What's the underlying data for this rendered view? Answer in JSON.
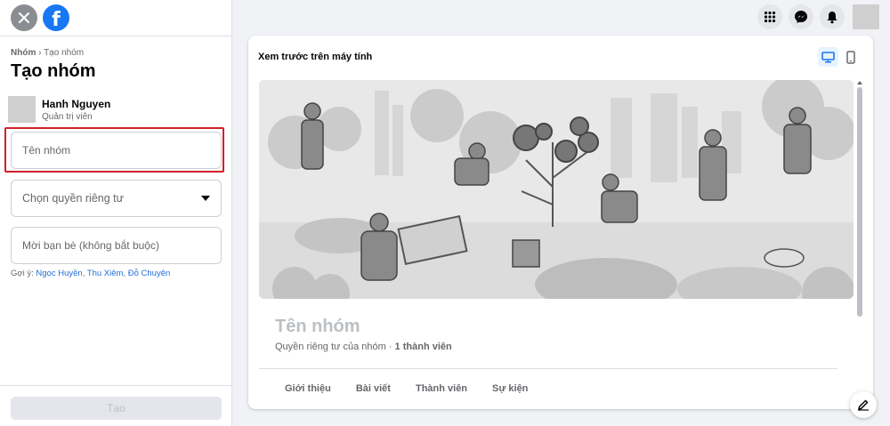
{
  "sidebar": {
    "breadcrumb": {
      "parent": "Nhóm",
      "separator": "›",
      "current": "Tạo nhóm"
    },
    "title": "Tạo nhóm",
    "admin": {
      "name": "Hanh Nguyen",
      "role": "Quản trị viên"
    },
    "group_name_field": {
      "placeholder": "Tên nhóm",
      "value": ""
    },
    "privacy_select": {
      "label": "Chọn quyền riêng tư"
    },
    "invite_field": {
      "placeholder": "Mời bạn bè (không bắt buộc)",
      "value": ""
    },
    "suggestions": {
      "prefix": "Gợi ý:",
      "names": [
        "Ngọc Huyền",
        "Thu Xiêm",
        "Đỗ Chuyên"
      ],
      "separator": ", "
    },
    "create_button": "Tạo"
  },
  "header": {
    "icons": [
      "menu-grid-icon",
      "messenger-icon",
      "notifications-bell-icon"
    ]
  },
  "preview": {
    "title": "Xem trước trên máy tính",
    "group_name": "Tên nhóm",
    "privacy_text": "Quyền riêng tư của nhóm",
    "dot": " · ",
    "member_count": "1 thành viên",
    "tabs": [
      "Giới thiệu",
      "Bài viết",
      "Thành viên",
      "Sự kiện"
    ]
  },
  "colors": {
    "brand": "#1877f2",
    "highlight_border": "#d0212b",
    "link": "#216fdb",
    "disabled_text": "#bcc0c4"
  }
}
